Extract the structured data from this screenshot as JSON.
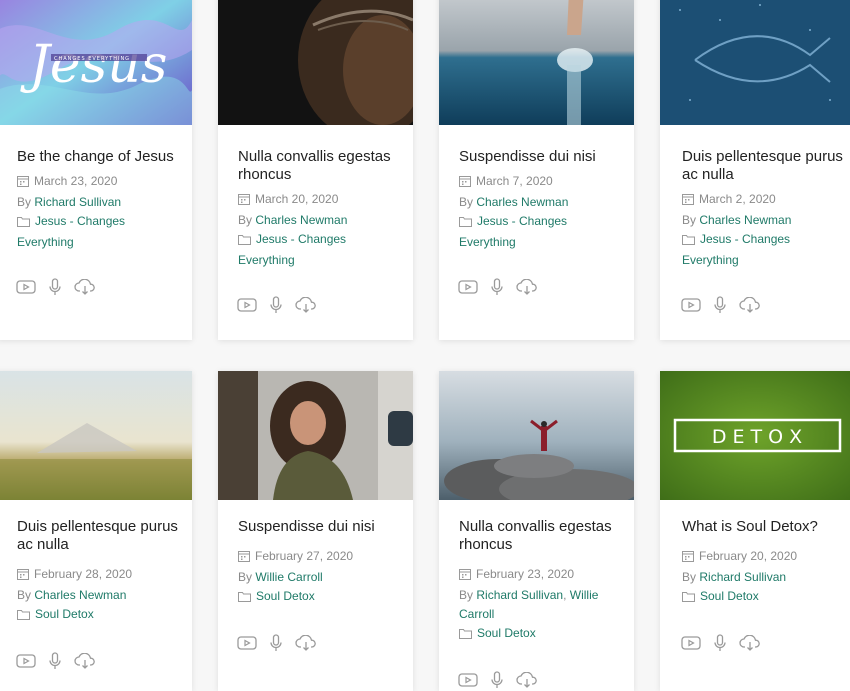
{
  "cards": [
    {
      "title": "Be the change of Jesus",
      "date": "March 23, 2020",
      "by": "By",
      "authors": [
        "Richard Sullivan"
      ],
      "category": "Jesus - Changes Everything",
      "thumb_text": "Jesus",
      "thumb_sub": "CHANGES EVERYTHING"
    },
    {
      "title": "Nulla convallis egestas rhoncus",
      "date": "March 20, 2020",
      "by": "By",
      "authors": [
        "Charles Newman"
      ],
      "category": "Jesus - Changes Everything"
    },
    {
      "title": "Suspendisse dui nisi",
      "date": "March 7, 2020",
      "by": "By",
      "authors": [
        "Charles Newman"
      ],
      "category": "Jesus - Changes Everything"
    },
    {
      "title": "Duis pellentesque purus ac nulla",
      "date": "March 2, 2020",
      "by": "By",
      "authors": [
        "Charles Newman"
      ],
      "category": "Jesus - Changes Everything"
    },
    {
      "title": "Duis pellentesque purus ac nulla",
      "date": "February 28, 2020",
      "by": "By",
      "authors": [
        "Charles Newman"
      ],
      "category": "Soul Detox"
    },
    {
      "title": "Suspendisse dui nisi",
      "date": "February 27, 2020",
      "by": "By",
      "authors": [
        "Willie Carroll"
      ],
      "category": "Soul Detox"
    },
    {
      "title": "Nulla convallis egestas rhoncus",
      "date": "February 23, 2020",
      "by": "By",
      "authors": [
        "Richard Sullivan",
        "Willie Carroll"
      ],
      "author_sep": ",",
      "category": "Soul Detox"
    },
    {
      "title": "What is Soul Detox?",
      "date": "February 20, 2020",
      "by": "By",
      "authors": [
        "Richard Sullivan"
      ],
      "category": "Soul Detox",
      "thumb_text": "D E T O X"
    }
  ],
  "colors": {
    "link": "#1f7a68",
    "meta": "#8a8a8a",
    "title": "#222222",
    "icon": "#9a9a9a"
  }
}
